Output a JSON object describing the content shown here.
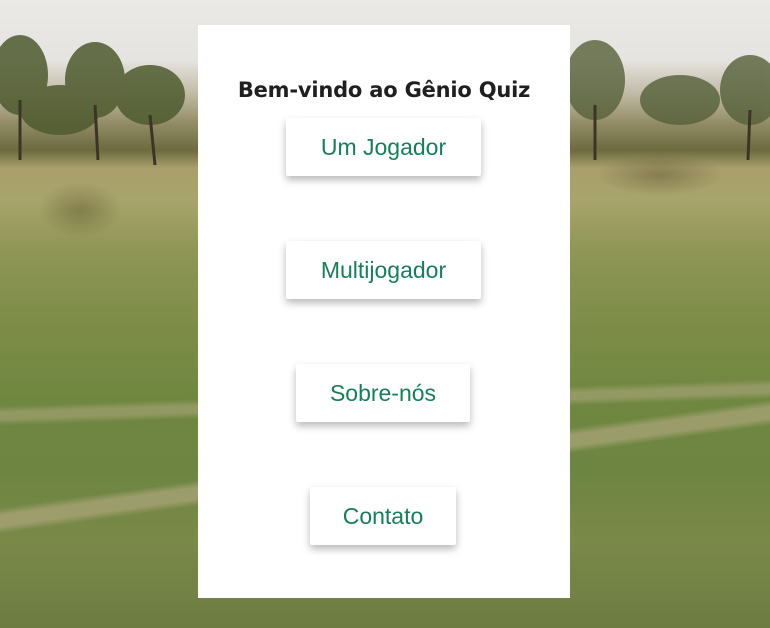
{
  "header": {
    "title": "Bem-vindo ao Gênio Quiz"
  },
  "menu": {
    "single_player": "Um Jogador",
    "multiplayer": "Multijogador",
    "about": "Sobre-nós",
    "contact": "Contato"
  },
  "colors": {
    "button_text": "#1a7c58",
    "title_text": "#1f1f1f",
    "panel_bg": "#ffffff"
  }
}
